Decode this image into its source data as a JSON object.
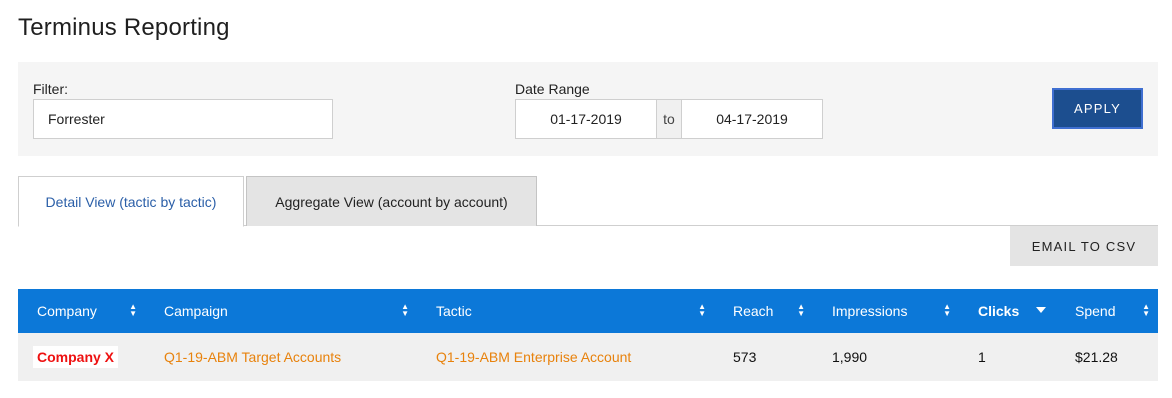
{
  "page": {
    "title": "Terminus Reporting"
  },
  "filter": {
    "label": "Filter:",
    "value": "Forrester"
  },
  "date_range": {
    "label": "Date Range",
    "start": "01-17-2019",
    "separator": "to",
    "end": "04-17-2019"
  },
  "apply_label": "APPLY",
  "tabs": [
    {
      "label": "Detail View (tactic by tactic)",
      "active": true
    },
    {
      "label": "Aggregate View (account by account)",
      "active": false
    }
  ],
  "email_csv_label": "EMAIL TO CSV",
  "table": {
    "columns": [
      {
        "label": "Company",
        "sort": "both"
      },
      {
        "label": "Campaign",
        "sort": "both"
      },
      {
        "label": "Tactic",
        "sort": "both"
      },
      {
        "label": "Reach",
        "sort": "both"
      },
      {
        "label": "Impressions",
        "sort": "both"
      },
      {
        "label": "Clicks",
        "sort": "desc"
      },
      {
        "label": "Spend",
        "sort": "both"
      }
    ],
    "rows": [
      {
        "company": "Company X",
        "campaign": "Q1-19-ABM Target Accounts",
        "tactic": "Q1-19-ABM Enterprise Account",
        "reach": "573",
        "impressions": "1,990",
        "clicks": "1",
        "spend": "$21.28"
      }
    ]
  },
  "colors": {
    "header_blue": "#0c78d8",
    "apply_blue": "#1c4e8f",
    "link_orange": "#e8820c",
    "logo_red": "#ee1111"
  }
}
